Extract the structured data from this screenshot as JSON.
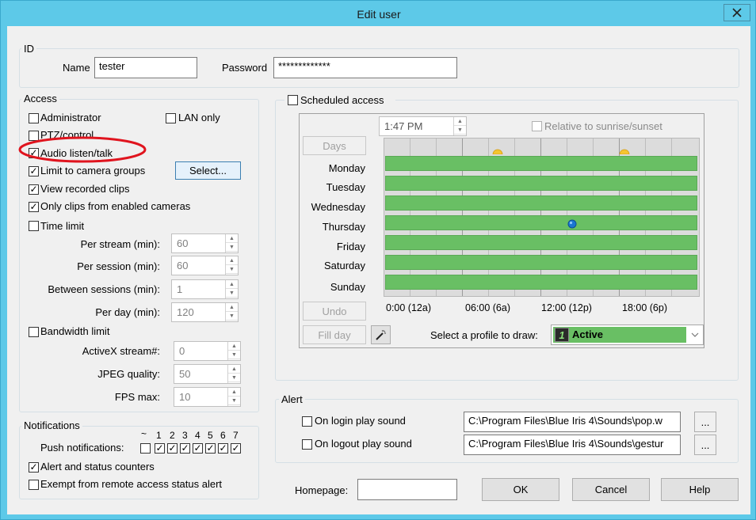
{
  "window": {
    "title": "Edit user"
  },
  "id_group": {
    "label": "ID",
    "name_label": "Name",
    "name_value": "tester",
    "password_label": "Password",
    "password_value": "*************"
  },
  "access": {
    "label": "Access",
    "administrator": "Administrator",
    "lan_only": "LAN only",
    "ptz": "PTZ/control",
    "audio": "Audio listen/talk",
    "limit_groups": "Limit to camera groups",
    "select_button": "Select...",
    "view_clips": "View recorded clips",
    "only_clips": "Only clips from enabled cameras",
    "time_limit": "Time limit",
    "per_stream_label": "Per stream (min):",
    "per_stream": "60",
    "per_session_label": "Per session (min):",
    "per_session": "60",
    "between_label": "Between sessions (min):",
    "between": "1",
    "per_day_label": "Per day (min):",
    "per_day": "120",
    "bandwidth": "Bandwidth limit",
    "activex_label": "ActiveX stream#:",
    "activex": "0",
    "jpeg_label": "JPEG quality:",
    "jpeg": "50",
    "fps_label": "FPS max:",
    "fps": "10"
  },
  "notifications": {
    "label": "Notifications",
    "push_label": "Push notifications:",
    "columns": [
      "~",
      "1",
      "2",
      "3",
      "4",
      "5",
      "6",
      "7"
    ],
    "alert_counters": "Alert and status counters",
    "exempt": "Exempt from remote access status alert"
  },
  "schedule": {
    "label": "Scheduled access",
    "time": "1:47 PM",
    "sunrise": "Relative to sunrise/sunset",
    "days_button": "Days",
    "days": [
      "Monday",
      "Tuesday",
      "Wednesday",
      "Thursday",
      "Friday",
      "Saturday",
      "Sunday"
    ],
    "times": [
      "0:00 (12a)",
      "06:00 (6a)",
      "12:00 (12p)",
      "18:00 (6p)"
    ],
    "undo": "Undo",
    "fill_day": "Fill day",
    "profile_label": "Select a profile to draw:",
    "profile_value": "Active",
    "profile_number": "1"
  },
  "alert": {
    "label": "Alert",
    "login_label": "On login play sound",
    "login_path": "C:\\Program Files\\Blue Iris 4\\Sounds\\pop.w",
    "logout_label": "On logout play sound",
    "logout_path": "C:\\Program Files\\Blue Iris 4\\Sounds\\gestur",
    "browse": "..."
  },
  "footer": {
    "homepage_label": "Homepage:",
    "ok": "OK",
    "cancel": "Cancel",
    "help": "Help"
  },
  "colors": {
    "titlebar": "#5dc9e8",
    "bar_green": "#69bf64",
    "annotation_red": "#e0141e"
  }
}
